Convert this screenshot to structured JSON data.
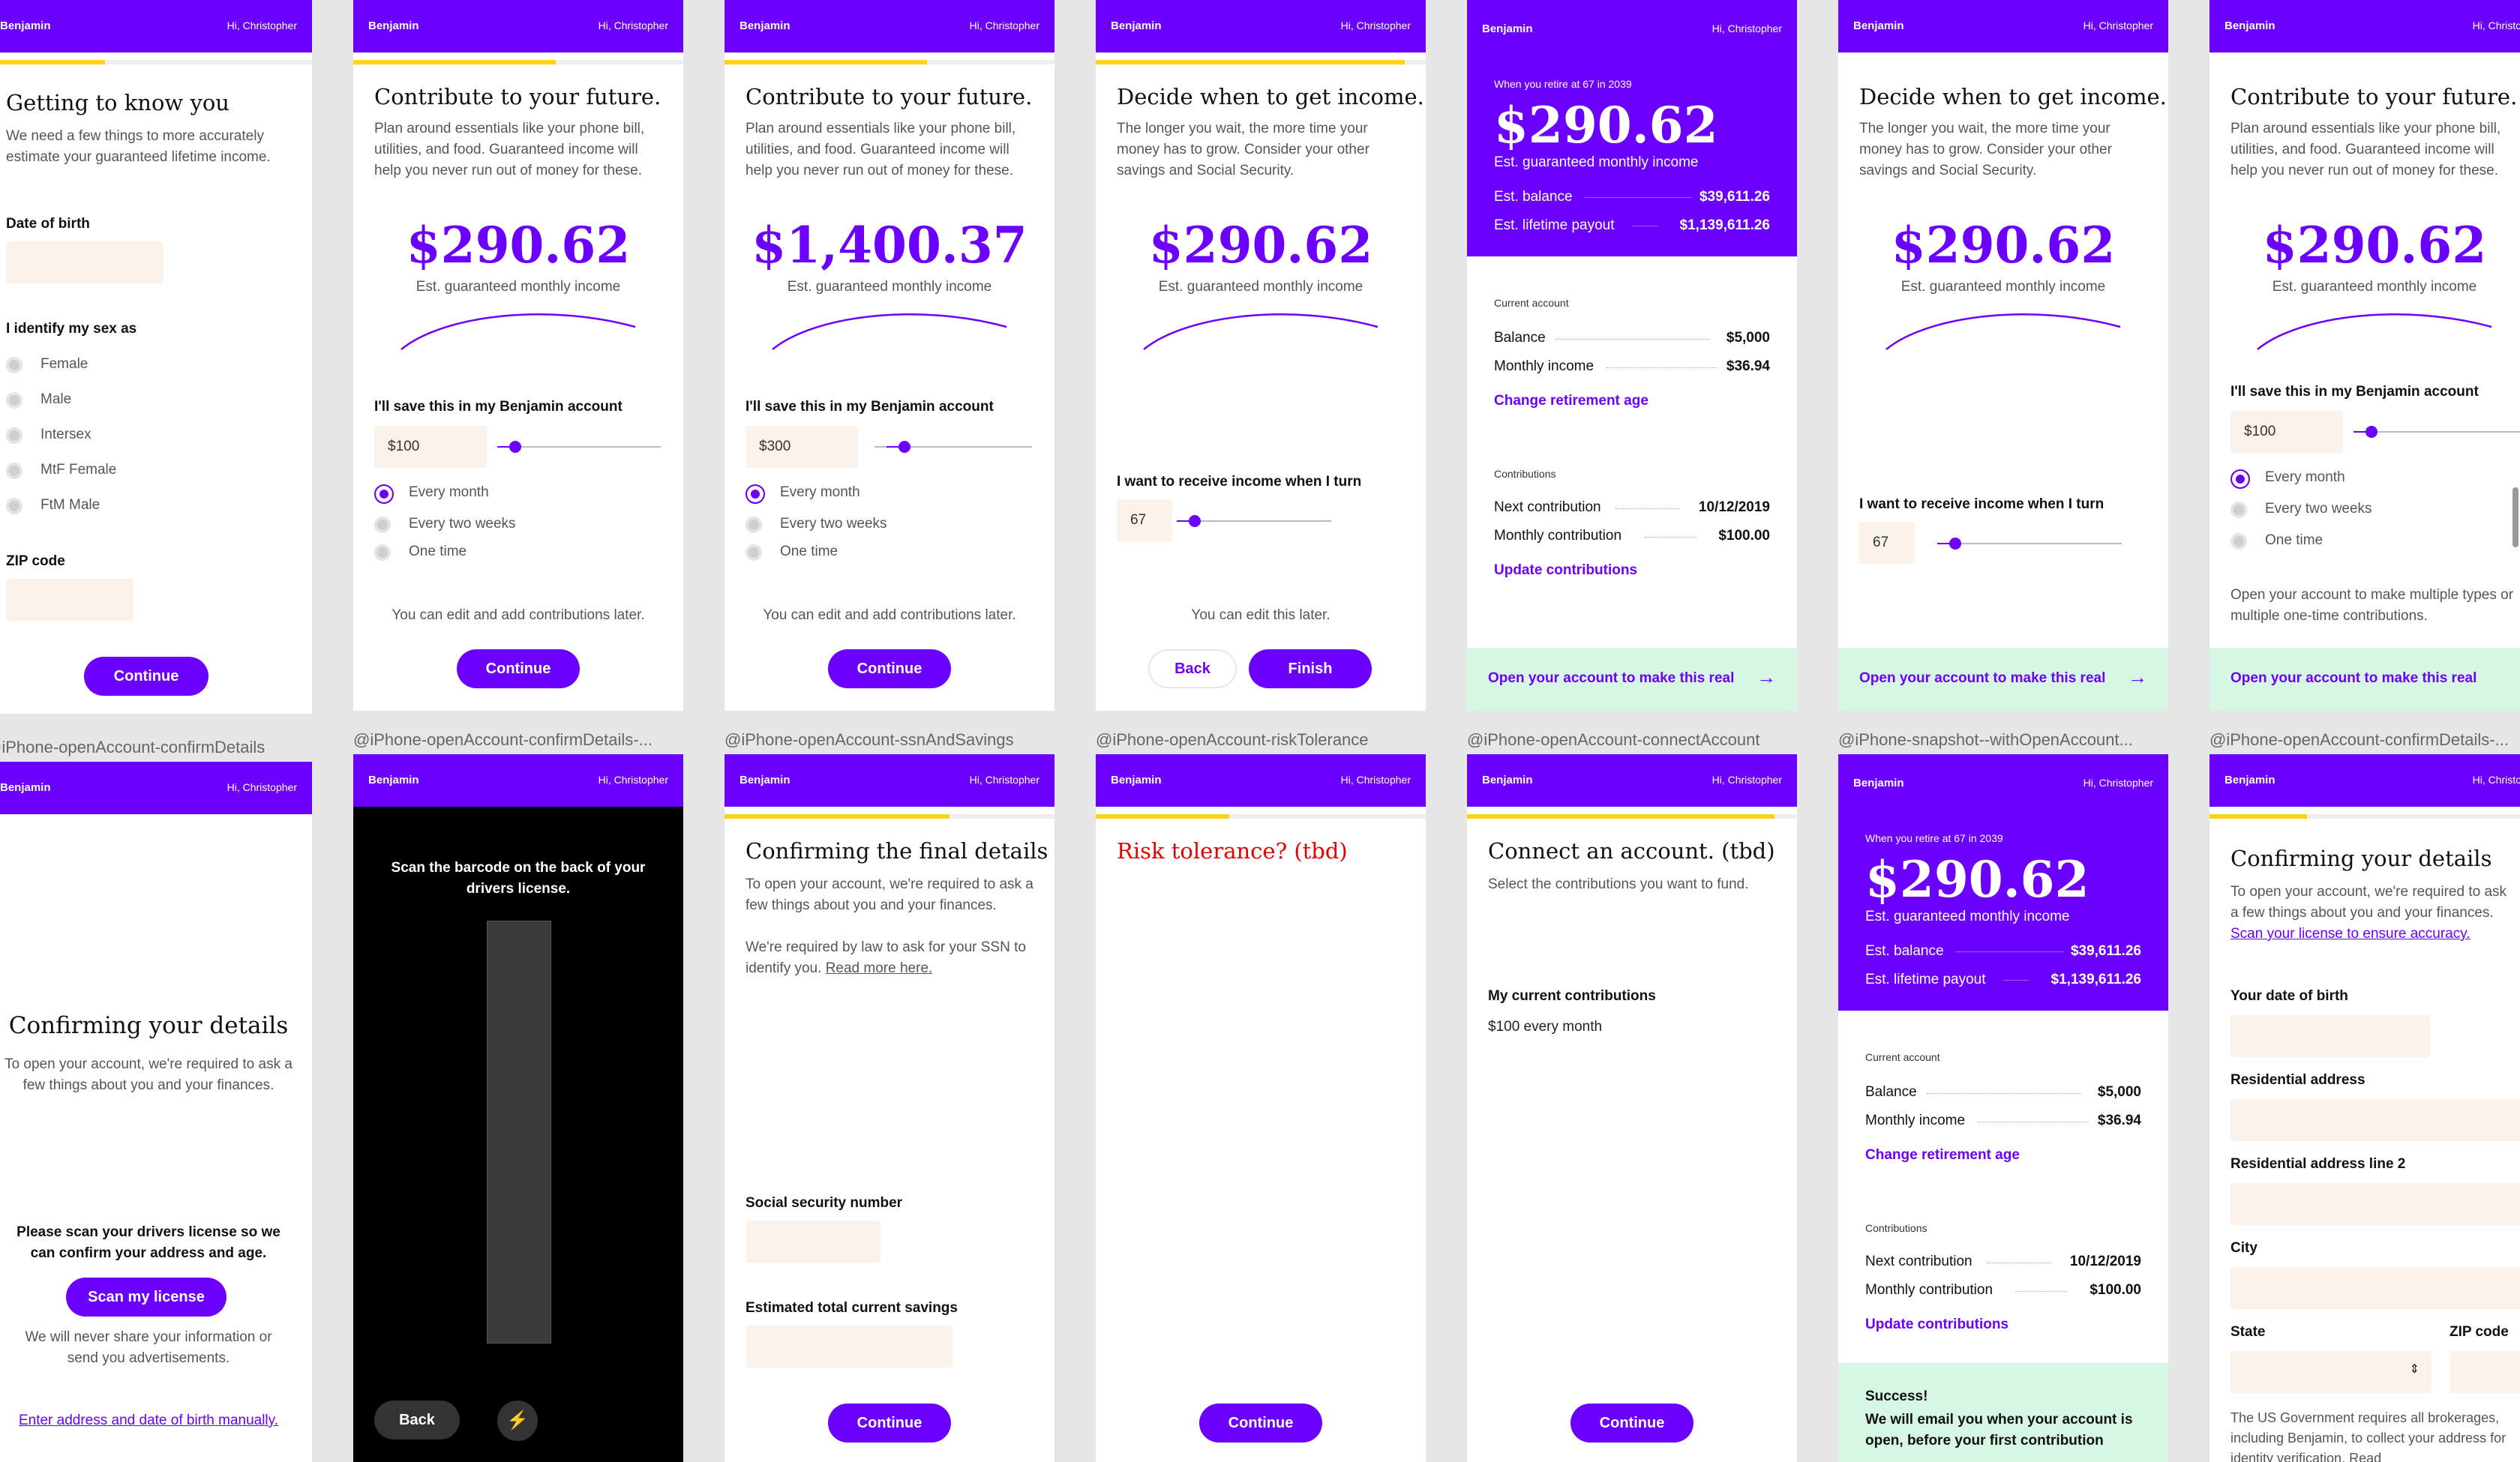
{
  "common": {
    "brand": "Benjamin",
    "greeting": "Hi, Christopher",
    "continue": "Continue",
    "back": "Back",
    "finish": "Finish",
    "open_account": "Open your account to make this real",
    "est_monthly": "Est. guaranteed monthly income",
    "edit_later": "You can edit and add contributions later.",
    "edit_this_later": "You can edit this later.",
    "save_label": "I'll save this in my Benjamin account",
    "receive_label": "I want to receive income when I turn",
    "freq": [
      "Every month",
      "Every two weeks",
      "One time"
    ],
    "contribute_title": "Contribute to your future.",
    "contribute_para": "Plan around essentials like your phone bill, utilities, and food. Guaranteed income will help you never run out of money for these.",
    "decide_title": "Decide when to get income.",
    "decide_para": "The longer you wait, the more time your money has to grow. Consider your other savings and Social Security."
  },
  "s1": {
    "title": "Getting to know you",
    "para": "We need a few things to more accurately estimate your guaranteed lifetime income.",
    "dob": "Date of birth",
    "sex": "I identify my sex as",
    "options": [
      "Female",
      "Male",
      "Intersex",
      "MtF Female",
      "FtM Male"
    ],
    "zip": "ZIP code"
  },
  "s2": {
    "amount": "$290.62",
    "save": "$100"
  },
  "s3": {
    "amount": "$1,400.37",
    "save": "$300"
  },
  "s4": {
    "amount": "$290.62",
    "age": "67"
  },
  "s5": {
    "when": "When you retire at 67 in 2039",
    "amount": "$290.62",
    "balance_k": "Est. balance",
    "balance_v": "$39,611.26",
    "lifetime_k": "Est. lifetime payout",
    "lifetime_v": "$1,139,611.26",
    "current": "Current account",
    "bal_k": "Balance",
    "bal_v": "$5,000",
    "mi_k": "Monthly income",
    "mi_v": "$36.94",
    "change": "Change retirement age",
    "contrib": "Contributions",
    "next_k": "Next contribution",
    "next_v": "10/12/2019",
    "mc_k": "Monthly contribution",
    "mc_v": "$100.00",
    "update": "Update contributions"
  },
  "s6": {
    "amount": "$290.62",
    "age": "67"
  },
  "s7": {
    "amount": "$290.62",
    "save": "$100",
    "para": "Open your account to make multiple types or multiple one-time contributions."
  },
  "captions": [
    "@iPhone-openAccount-confirmDetails",
    "@iPhone-openAccount-confirmDetails-...",
    "@iPhone-openAccount-ssnAndSavings",
    "@iPhone-openAccount-riskTolerance",
    "@iPhone-openAccount-connectAccount",
    "@iPhone-snapshot--withOpenAccount...",
    "@iPhone-openAccount-confirmDetails-..."
  ],
  "b1": {
    "title": "Confirming your details",
    "para": "To open your account, we're required to ask a few things about you and your finances.",
    "scan_note": "Please scan your drivers license so we can confirm your address and age.",
    "scan_btn": "Scan my license",
    "never": "We will never share your information or send you advertisements.",
    "manual": "Enter address and date of birth manually."
  },
  "b2": {
    "instr": "Scan the barcode on the back of your drivers license.",
    "back": "Back"
  },
  "b3": {
    "title": "Confirming the final details",
    "para1": "To open your account, we're required to ask a few things about you and your finances.",
    "para2": "We're required by law to ask for your SSN to identify you.",
    "read_more": "Read more here.",
    "ssn": "Social security number",
    "savings": "Estimated total current savings"
  },
  "b4": {
    "title": "Risk tolerance? (tbd)"
  },
  "b5": {
    "title": "Connect an account. (tbd)",
    "para": "Select the contributions you want to fund.",
    "label": "My current contributions",
    "value": "$100 every month"
  },
  "b6": {
    "success1": "Success!",
    "success2": "We will email you when your account is open, before your first contribution"
  },
  "b7": {
    "title": "Confirming your details",
    "para": "To open your account, we're required to ask a few things about you and your finances.",
    "scan": "Scan your license to ensure accuracy.",
    "dob": "Your date of birth",
    "addr": "Residential address",
    "addr2": "Residential address line 2",
    "city": "City",
    "state": "State",
    "zip": "ZIP code",
    "note": "The US Government requires all brokerages, including Benjamin, to collect your address for identity verification. Read"
  }
}
